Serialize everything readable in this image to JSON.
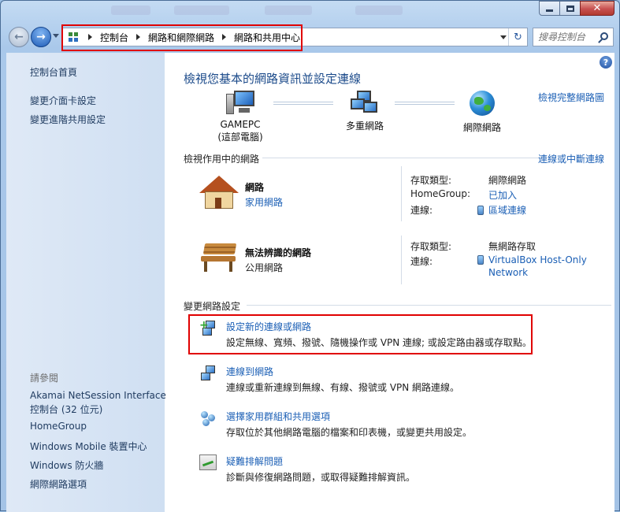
{
  "window": {
    "caption": {
      "minimize": "minimize",
      "maximize": "maximize",
      "close": "✕"
    }
  },
  "address": {
    "breadcrumbs": [
      "控制台",
      "網路和網際網路",
      "網路和共用中心"
    ],
    "search_placeholder": "搜尋控制台"
  },
  "sidebar": {
    "items": [
      {
        "label": "控制台首頁"
      },
      {
        "label": "變更介面卡設定"
      },
      {
        "label": "變更進階共用設定"
      }
    ],
    "see_also_heading": "請參閱",
    "see_also": [
      {
        "label": "Akamai NetSession Interface"
      },
      {
        "label": "控制台 (32 位元)"
      },
      {
        "label": "HomeGroup"
      },
      {
        "label": "Windows Mobile 裝置中心"
      },
      {
        "label": "Windows 防火牆"
      },
      {
        "label": "網際網路選項"
      }
    ]
  },
  "main": {
    "title": "檢視您基本的網路資訊並設定連線",
    "full_map_link": "檢視完整網路圖",
    "map": {
      "computer_name": "GAMEPC",
      "computer_sub": "(這部電腦)",
      "middle": "多重網路",
      "internet": "網際網路"
    },
    "active": {
      "heading": "檢視作用中的網路",
      "connect_link": "連線或中斷連線",
      "networks": [
        {
          "name": "網路",
          "type": "家用網路",
          "props": [
            {
              "label": "存取類型:",
              "value": "網際網路"
            },
            {
              "label": "HomeGroup:",
              "value": "已加入"
            },
            {
              "label": "連線:",
              "value": "區域連線"
            }
          ]
        },
        {
          "name": "無法辨識的網路",
          "type": "公用網路",
          "props": [
            {
              "label": "存取類型:",
              "value": "無網路存取"
            },
            {
              "label": "連線:",
              "value": "VirtualBox Host-Only",
              "value2": "Network"
            }
          ]
        }
      ]
    },
    "change": {
      "heading": "變更網路設定",
      "tasks": [
        {
          "title": "設定新的連線或網路",
          "desc": "設定無線、寬頻、撥號、隨機操作或 VPN 連線; 或設定路由器或存取點。"
        },
        {
          "title": "連線到網路",
          "desc": "連線或重新連線到無線、有線、撥號或 VPN 網路連線。"
        },
        {
          "title": "選擇家用群組和共用選項",
          "desc": "存取位於其他網路電腦的檔案和印表機，或變更共用設定。"
        },
        {
          "title": "疑難排解問題",
          "desc": "診斷與修復網路問題，或取得疑難排解資訊。"
        }
      ]
    }
  }
}
